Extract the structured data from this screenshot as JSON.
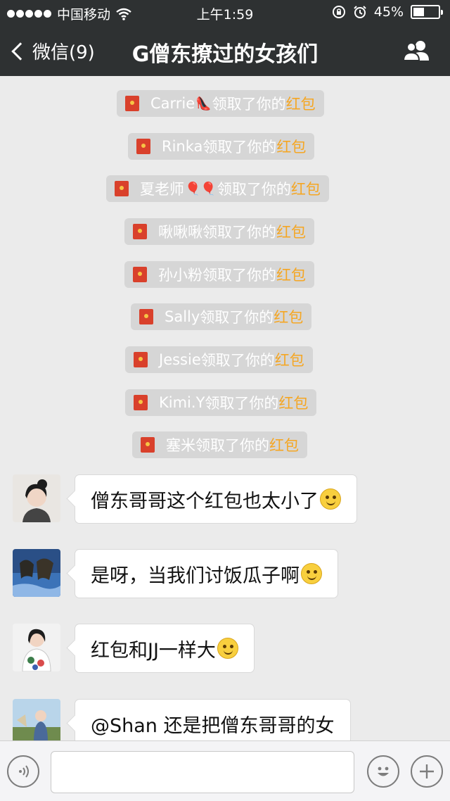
{
  "status_bar": {
    "carrier": "中国移动",
    "time": "上午1:59",
    "battery_percent": "45%",
    "battery_level": 0.45
  },
  "nav": {
    "back_label": "微信(9)",
    "title": "G僧东撩过的女孩们",
    "icons": [
      "chevron-left-icon",
      "group-members-icon"
    ]
  },
  "notices": [
    {
      "name": "Carrie",
      "emoji": "👠",
      "suffix": "领取了你的",
      "highlight": "红包"
    },
    {
      "name": "Rinka",
      "emoji": "",
      "suffix": "领取了你的",
      "highlight": "红包"
    },
    {
      "name": "夏老师",
      "emoji": "🎈🎈",
      "suffix": "领取了你的",
      "highlight": "红包"
    },
    {
      "name": "啾啾啾",
      "emoji": "",
      "suffix": "领取了你的",
      "highlight": "红包"
    },
    {
      "name": "孙小粉",
      "emoji": "",
      "suffix": "领取了你的",
      "highlight": "红包"
    },
    {
      "name": "Sally",
      "emoji": "",
      "suffix": "领取了你的",
      "highlight": "红包"
    },
    {
      "name": "Jessie",
      "emoji": "",
      "suffix": "领取了你的",
      "highlight": "红包"
    },
    {
      "name": "Kimi.Y",
      "emoji": "",
      "suffix": "领取了你的",
      "highlight": "红包"
    },
    {
      "name": "塞米",
      "emoji": "",
      "suffix": "领取了你的",
      "highlight": "红包"
    }
  ],
  "messages": [
    {
      "text": "僧东哥哥这个红包也太小了",
      "emoji": "smile-emoji"
    },
    {
      "text": "是呀，当我们讨饭瓜子啊",
      "emoji": "smile-emoji"
    },
    {
      "text": "红包和JJ一样大",
      "emoji": "smile-emoji"
    },
    {
      "text": "@Shan 还是把僧东哥哥的女",
      "emoji": ""
    }
  ],
  "input_bar": {
    "icons": [
      "voice-icon",
      "emoji-icon",
      "plus-icon"
    ],
    "placeholder": ""
  },
  "colors": {
    "navbar": "#2e3132",
    "background": "#ebebeb",
    "notice_bg": "#d6d6d6",
    "highlight": "#f5a623",
    "red_packet": "#d9402b"
  }
}
